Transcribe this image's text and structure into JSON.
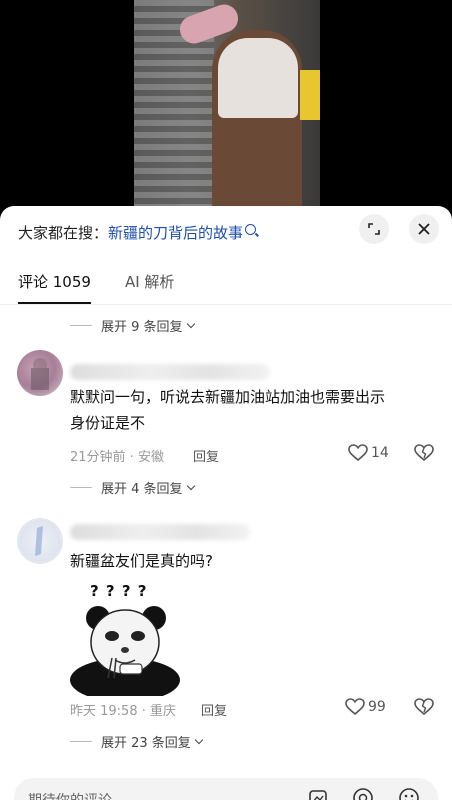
{
  "search": {
    "prefix": "大家都在搜：",
    "query": "新疆的刀背后的故事"
  },
  "tabs": [
    {
      "label": "评论 1059"
    },
    {
      "label": "AI 解析"
    }
  ],
  "top_expand": "展开 9 条回复",
  "comments": [
    {
      "text_line1": "默默问一句，听说去新疆加油站加油也需要出示",
      "text_line2": "身份证是不",
      "time_location": "21分钟前 · 安徽",
      "reply_label": "回复",
      "likes": "14",
      "expand": "展开 4 条回复"
    },
    {
      "text": "新疆盆友们是真的吗?",
      "sticker_text": "? ? ? ?",
      "time_location": "昨天 19:58 · 重庆",
      "reply_label": "回复",
      "likes": "99",
      "expand": "展开 23 条回复"
    }
  ],
  "input": {
    "placeholder": "期待你的评论"
  },
  "colors": {
    "link": "#1f4fb0",
    "text": "#111111",
    "meta": "#999999"
  }
}
